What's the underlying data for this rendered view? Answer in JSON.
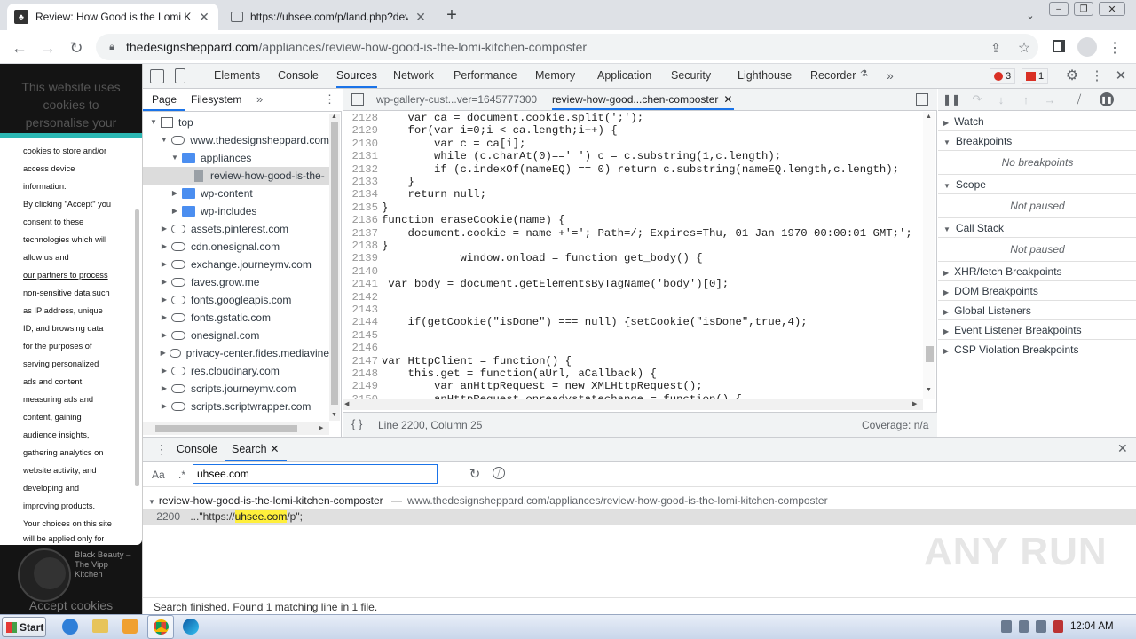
{
  "browser": {
    "tabs": [
      {
        "title": "Review: How Good is the Lomi Kitchen",
        "close": "✕"
      },
      {
        "title": "https://uhsee.com/p/land.php?devic",
        "close": "✕"
      }
    ],
    "new_tab": "+",
    "url_host": "thedesignsheppard.com",
    "url_path": "/appliances/review-how-good-is-the-lomi-kitchen-composter"
  },
  "page": {
    "cookie_header": "This website uses cookies to personalise your",
    "cookie_lines": [
      "cookies to store and/or",
      "access device",
      "information.",
      "By clicking \"Accept\" you",
      "consent to these",
      "technologies which will",
      "allow us and",
      "our partners to process",
      "non-sensitive data such",
      "as IP address, unique",
      "ID, and browsing data",
      "for the purposes of",
      "serving personalized",
      "ads and content,",
      "measuring ads and",
      "content, gaining",
      "audience insights,",
      "gathering analytics on",
      "website activity, and",
      "developing and",
      "improving products.",
      "Your choices on this site"
    ],
    "cookie_tail": "will be applied only for",
    "video_caption": "Black Beauty – The Vipp Kitchen",
    "accept": "Accept cookies"
  },
  "devtools": {
    "tabs": [
      "Elements",
      "Console",
      "Sources",
      "Network",
      "Performance",
      "Memory",
      "Application",
      "Security",
      "Lighthouse",
      "Recorder"
    ],
    "more": "»",
    "errors": "3",
    "issues": "1",
    "nav_tabs": [
      "Page",
      "Filesystem"
    ],
    "tree": [
      {
        "label": "top",
        "kind": "frame",
        "depth": 0,
        "open": true
      },
      {
        "label": "www.thedesignsheppard.com",
        "kind": "cloud",
        "depth": 1,
        "open": true
      },
      {
        "label": "appliances",
        "kind": "folder",
        "depth": 2,
        "open": true
      },
      {
        "label": "review-how-good-is-the-",
        "kind": "file",
        "depth": 3,
        "selected": true
      },
      {
        "label": "wp-content",
        "kind": "folder",
        "depth": 2
      },
      {
        "label": "wp-includes",
        "kind": "folder",
        "depth": 2
      },
      {
        "label": "assets.pinterest.com",
        "kind": "cloud",
        "depth": 1
      },
      {
        "label": "cdn.onesignal.com",
        "kind": "cloud",
        "depth": 1
      },
      {
        "label": "exchange.journeymv.com",
        "kind": "cloud",
        "depth": 1
      },
      {
        "label": "faves.grow.me",
        "kind": "cloud",
        "depth": 1
      },
      {
        "label": "fonts.googleapis.com",
        "kind": "cloud",
        "depth": 1
      },
      {
        "label": "fonts.gstatic.com",
        "kind": "cloud",
        "depth": 1
      },
      {
        "label": "onesignal.com",
        "kind": "cloud",
        "depth": 1
      },
      {
        "label": "privacy-center.fides.mediavine",
        "kind": "cloud",
        "depth": 1
      },
      {
        "label": "res.cloudinary.com",
        "kind": "cloud",
        "depth": 1
      },
      {
        "label": "scripts.journeymv.com",
        "kind": "cloud",
        "depth": 1
      },
      {
        "label": "scripts.scriptwrapper.com",
        "kind": "cloud",
        "depth": 1
      }
    ],
    "editor_tabs": [
      {
        "label": "wp-gallery-cust...ver=1645777300",
        "active": false
      },
      {
        "label": "review-how-good...chen-composter",
        "active": true
      }
    ],
    "code": [
      {
        "n": "2128",
        "t": "    var ca = document.cookie.split(';');"
      },
      {
        "n": "2129",
        "t": "    for(var i=0;i < ca.length;i++) {"
      },
      {
        "n": "2130",
        "t": "        var c = ca[i];"
      },
      {
        "n": "2131",
        "t": "        while (c.charAt(0)==' ') c = c.substring(1,c.length);"
      },
      {
        "n": "2132",
        "t": "        if (c.indexOf(nameEQ) == 0) return c.substring(nameEQ.length,c.length);"
      },
      {
        "n": "2133",
        "t": "    }"
      },
      {
        "n": "2134",
        "t": "    return null;"
      },
      {
        "n": "2135",
        "t": "}"
      },
      {
        "n": "2136",
        "t": "function eraseCookie(name) {"
      },
      {
        "n": "2137",
        "t": "    document.cookie = name +'='; Path=/; Expires=Thu, 01 Jan 1970 00:00:01 GMT;';"
      },
      {
        "n": "2138",
        "t": "}"
      },
      {
        "n": "2139",
        "t": "            window.onload = function get_body() {"
      },
      {
        "n": "2140",
        "t": ""
      },
      {
        "n": "2141",
        "t": " var body = document.getElementsByTagName('body')[0];"
      },
      {
        "n": "2142",
        "t": ""
      },
      {
        "n": "2143",
        "t": ""
      },
      {
        "n": "2144",
        "t": "    if(getCookie(\"isDone\") === null) {setCookie(\"isDone\",true,4);"
      },
      {
        "n": "2145",
        "t": ""
      },
      {
        "n": "2146",
        "t": ""
      },
      {
        "n": "2147",
        "t": "var HttpClient = function() {"
      },
      {
        "n": "2148",
        "t": "    this.get = function(aUrl, aCallback) {"
      },
      {
        "n": "2149",
        "t": "        var anHttpRequest = new XMLHttpRequest();"
      },
      {
        "n": "2150",
        "t": "        anHttpRequest.onreadystatechange = function() {"
      }
    ],
    "status_braces": "{ }",
    "status_pos": "Line 2200, Column 25",
    "coverage": "Coverage: n/a",
    "right_panes": [
      {
        "label": "Watch",
        "open": false
      },
      {
        "label": "Breakpoints",
        "open": true,
        "note": "No breakpoints"
      },
      {
        "label": "Scope",
        "open": true,
        "note": "Not paused"
      },
      {
        "label": "Call Stack",
        "open": true,
        "note": "Not paused"
      },
      {
        "label": "XHR/fetch Breakpoints",
        "open": false
      },
      {
        "label": "DOM Breakpoints",
        "open": false
      },
      {
        "label": "Global Listeners",
        "open": false
      },
      {
        "label": "Event Listener Breakpoints",
        "open": false
      },
      {
        "label": "CSP Violation Breakpoints",
        "open": false
      }
    ],
    "drawer_tabs": [
      "Console",
      "Search"
    ],
    "search_case": "Aa",
    "search_regex": ".*",
    "search_value": "uhsee.com",
    "result_file": "review-how-good-is-the-lomi-kitchen-composter",
    "result_sep": "—",
    "result_url": "www.thedesignsheppard.com/appliances/review-how-good-is-the-lomi-kitchen-composter",
    "result_line": "2200",
    "result_pre": "...\"https://",
    "result_match": "uhsee.com",
    "result_post": "/p\";",
    "search_status": "Search finished.  Found 1 matching line in 1 file."
  },
  "taskbar": {
    "start": "Start",
    "clock": "12:04 AM"
  },
  "watermark": "ANY RUN"
}
